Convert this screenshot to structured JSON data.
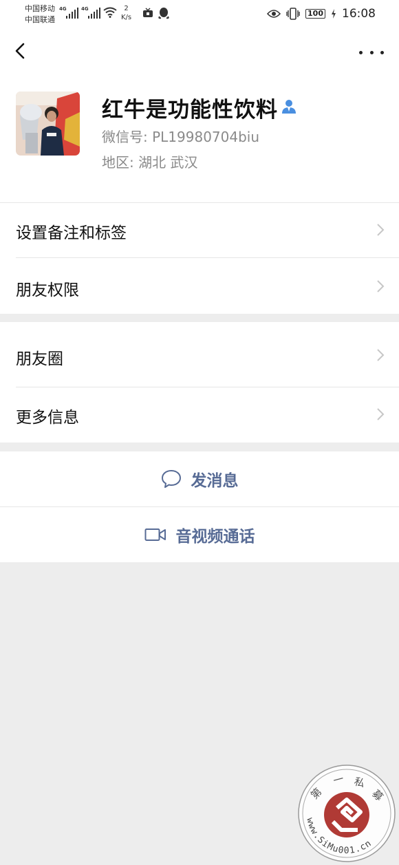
{
  "status_bar": {
    "carrier_1": "中国移动",
    "carrier_2": "中国联通",
    "network_1": "4G",
    "network_2": "4G",
    "speed_value": "2",
    "speed_unit": "K/s",
    "battery": "100",
    "time": "16:08"
  },
  "profile": {
    "nickname": "红牛是功能性饮料",
    "wechat_id": "微信号:  PL19980704biu",
    "region": "地区:  湖北  武汉"
  },
  "menu_group_1": [
    {
      "label": "设置备注和标签"
    },
    {
      "label": "朋友权限"
    }
  ],
  "menu_group_2": [
    {
      "label": "朋友圈"
    },
    {
      "label": "更多信息"
    }
  ],
  "actions": {
    "send_message": "发消息",
    "av_call": "音视频通话"
  },
  "watermark": {
    "chars": [
      "第",
      "一",
      "私",
      "募"
    ],
    "url": "www.SiMu001.cn"
  },
  "colors": {
    "link": "#576b95",
    "background": "#ededed",
    "watermark_red": "#b03a35"
  }
}
